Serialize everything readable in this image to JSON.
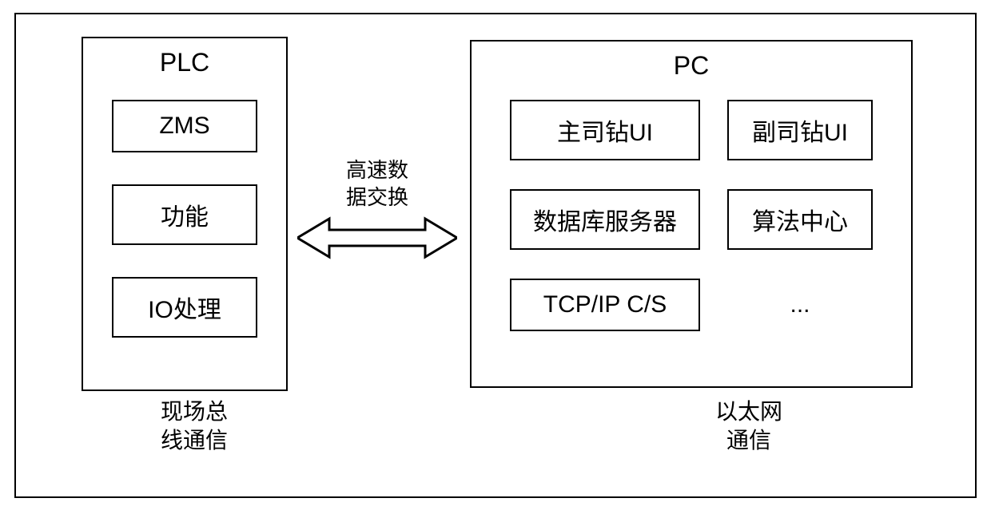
{
  "plc": {
    "title": "PLC",
    "boxes": [
      "ZMS",
      "功能",
      "IO处理"
    ],
    "footer": "现场总\n线通信"
  },
  "pc": {
    "title": "PC",
    "rows": [
      {
        "left": "主司钻UI",
        "right": "副司钻UI"
      },
      {
        "left": "数据库服务器",
        "right": "算法中心"
      },
      {
        "left": "TCP/IP C/S",
        "right": "..."
      }
    ],
    "footer": "以太网\n通信"
  },
  "link": {
    "label": "高速数\n据交换"
  }
}
